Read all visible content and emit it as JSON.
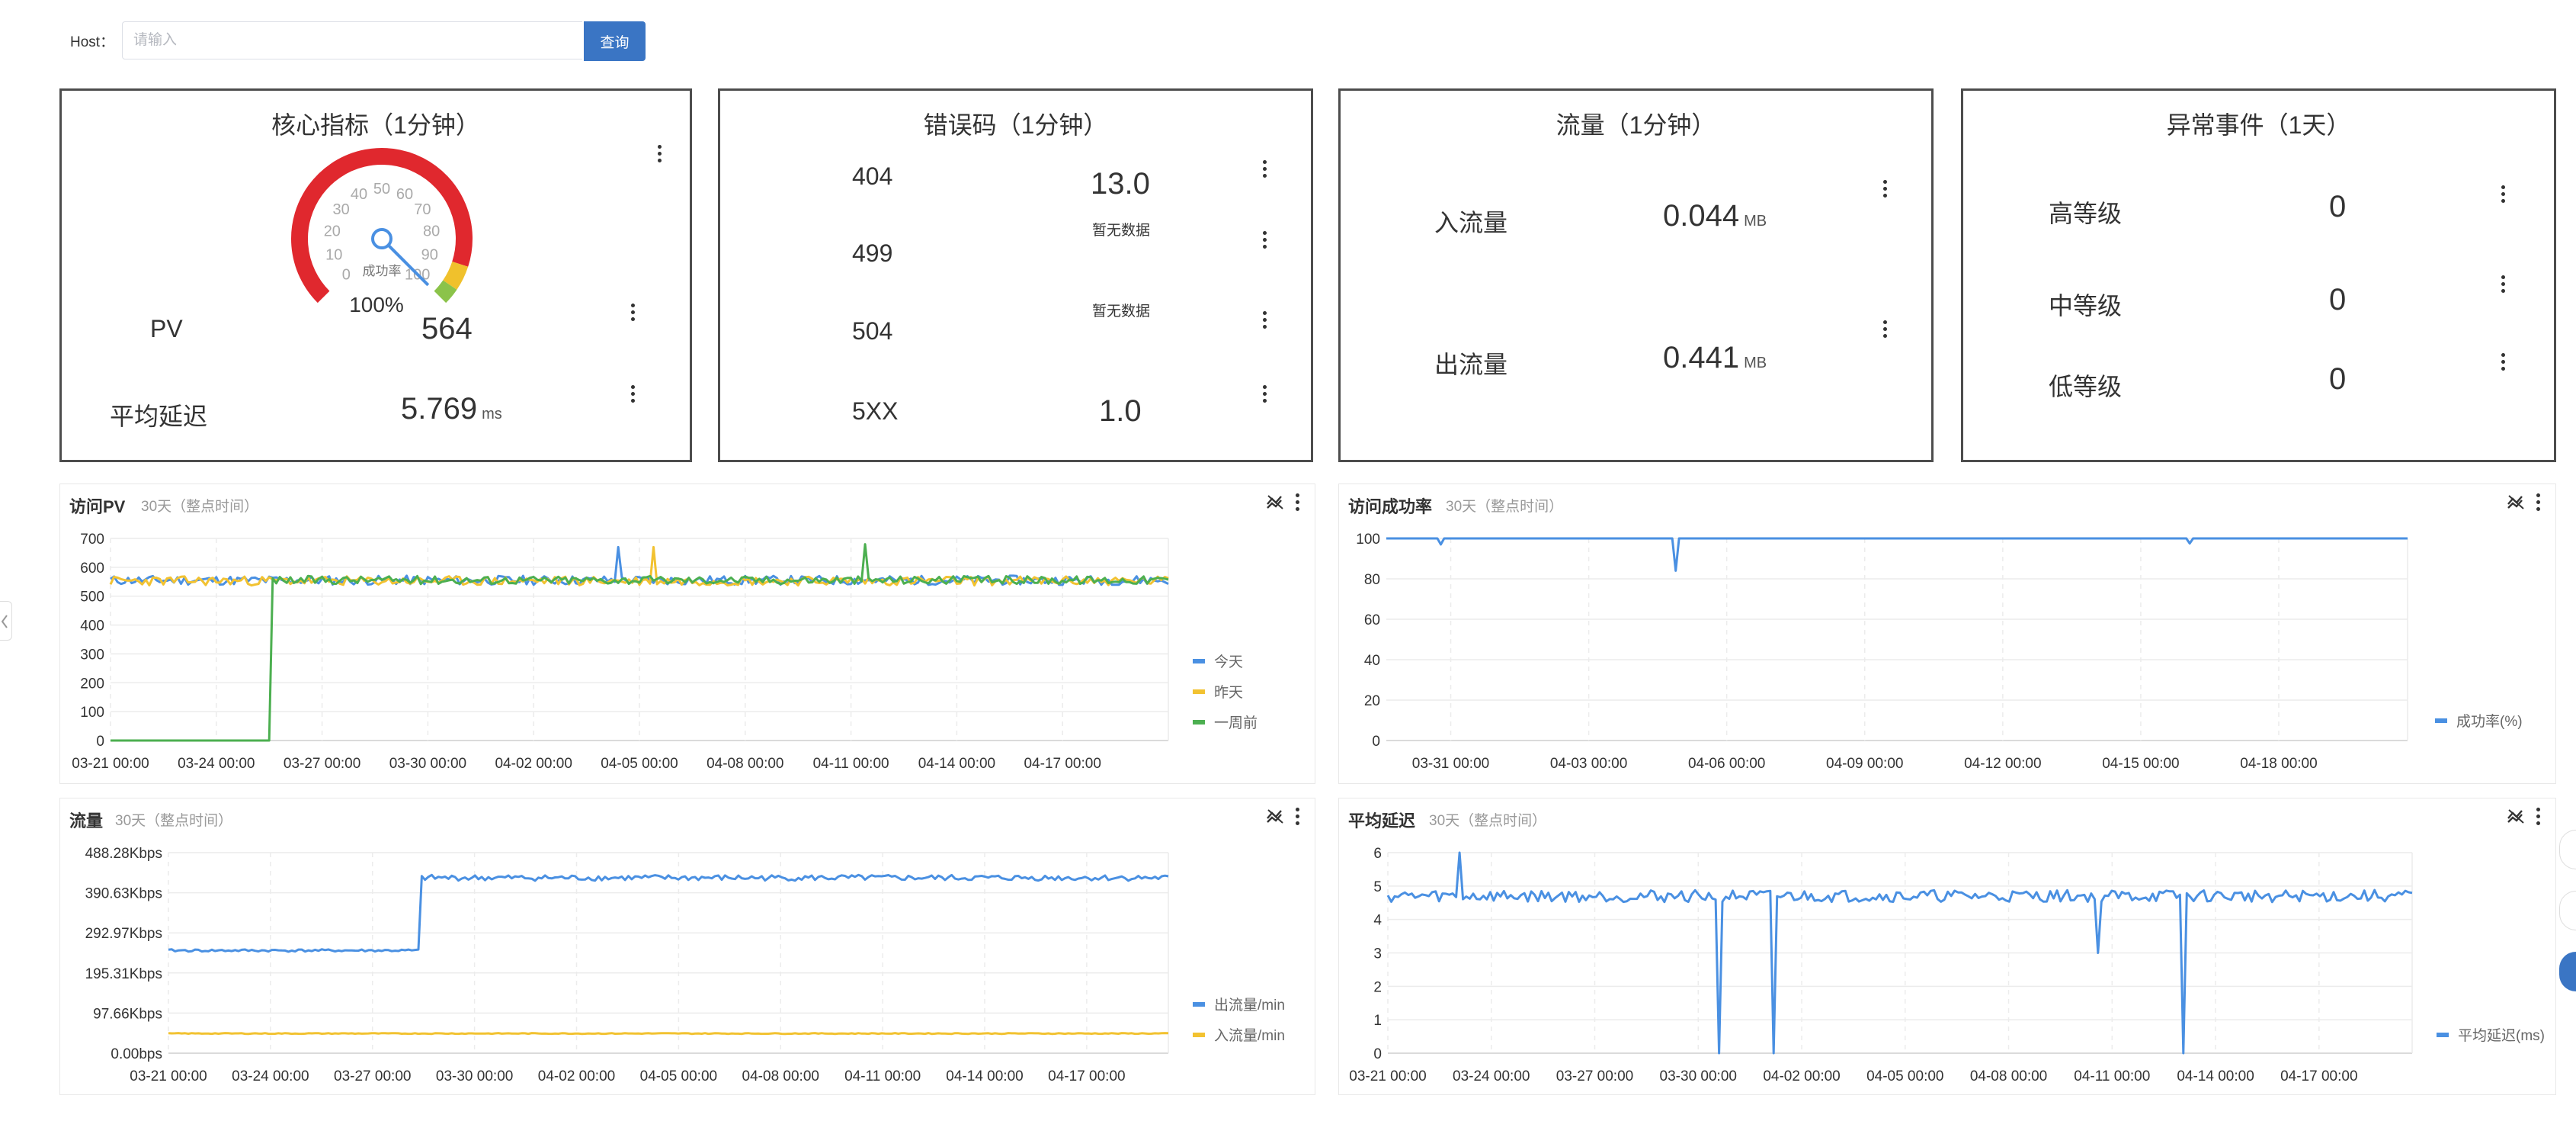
{
  "search": {
    "label": "Host：",
    "placeholder": "请输入",
    "value": "",
    "button": "查询"
  },
  "cards": {
    "core": {
      "title": "核心指标（1分钟）",
      "gauge": {
        "ticks": [
          "0",
          "10",
          "20",
          "30",
          "40",
          "50",
          "60",
          "70",
          "80",
          "90",
          "100"
        ],
        "caption": "成功率",
        "value_text": "100%",
        "value": 100
      },
      "pv": {
        "label": "PV",
        "value": "564"
      },
      "latency": {
        "label": "平均延迟",
        "value": "5.769",
        "unit": "ms"
      }
    },
    "errors": {
      "title": "错误码（1分钟）",
      "rows": [
        {
          "code": "404",
          "value": "13.0"
        },
        {
          "code": "499",
          "value": "暂无数据"
        },
        {
          "code": "504",
          "value": "暂无数据"
        },
        {
          "code": "5XX",
          "value": "1.0"
        }
      ]
    },
    "traffic": {
      "title": "流量（1分钟）",
      "inbound": {
        "label": "入流量",
        "value": "0.044",
        "unit": "MB"
      },
      "outbound": {
        "label": "出流量",
        "value": "0.441",
        "unit": "MB"
      }
    },
    "events": {
      "title": "异常事件（1天）",
      "rows": [
        {
          "level": "高等级",
          "value": "0"
        },
        {
          "level": "中等级",
          "value": "0"
        },
        {
          "level": "低等级",
          "value": "0"
        }
      ]
    }
  },
  "chart_data": [
    {
      "id": "pv",
      "type": "line",
      "title": "访问PV",
      "subtitle": "30天（整点时间）",
      "x_ticks": [
        "03-21 00:00",
        "03-24 00:00",
        "03-27 00:00",
        "03-30 00:00",
        "04-02 00:00",
        "04-05 00:00",
        "04-08 00:00",
        "04-11 00:00",
        "04-14 00:00",
        "04-17 00:00"
      ],
      "x_range": [
        0,
        30
      ],
      "ylim": [
        0,
        700
      ],
      "y_ticks": [
        "0",
        "100",
        "200",
        "300",
        "400",
        "500",
        "600",
        "700"
      ],
      "grid": true,
      "legend_position": "bottom-right",
      "series": [
        {
          "name": "今天",
          "color": "#4a90e2",
          "base": 555,
          "amp": 16,
          "seed": 11,
          "spikes": [
            [
              14.4,
              670
            ]
          ]
        },
        {
          "name": "昨天",
          "color": "#f2c231",
          "base": 553,
          "amp": 16,
          "seed": 23,
          "spikes": [
            [
              15.4,
              670
            ]
          ]
        },
        {
          "name": "一周前",
          "color": "#4caf50",
          "base": 556,
          "amp": 14,
          "seed": 37,
          "spikes": [
            [
              21.4,
              680
            ]
          ],
          "zero_until": 4.6
        }
      ]
    },
    {
      "id": "success",
      "type": "line",
      "title": "访问成功率",
      "subtitle": "30天（整点时间）",
      "x_ticks": [
        "03-31 00:00",
        "04-03 00:00",
        "04-06 00:00",
        "04-09 00:00",
        "04-12 00:00",
        "04-15 00:00",
        "04-18 00:00"
      ],
      "x_range": [
        0,
        22.2
      ],
      "ylim": [
        0,
        100
      ],
      "y_ticks": [
        "0",
        "20",
        "40",
        "60",
        "80",
        "100"
      ],
      "grid": true,
      "legend_position": "bottom-right",
      "series": [
        {
          "name": "成功率(%)",
          "color": "#4a90e2",
          "base": 100,
          "amp": 0,
          "seed": 5,
          "dips": [
            [
              1.2,
              97
            ],
            [
              6.3,
              84
            ],
            [
              17.5,
              97.5
            ]
          ]
        }
      ]
    },
    {
      "id": "traffic",
      "type": "line",
      "title": "流量",
      "subtitle": "30天（整点时间）",
      "x_ticks": [
        "03-21 00:00",
        "03-24 00:00",
        "03-27 00:00",
        "03-30 00:00",
        "04-02 00:00",
        "04-05 00:00",
        "04-08 00:00",
        "04-11 00:00",
        "04-14 00:00",
        "04-17 00:00"
      ],
      "x_range": [
        0,
        29.4
      ],
      "ylim": [
        0,
        488.28
      ],
      "y_ticks": [
        "0.00bps",
        "97.66Kbps",
        "195.31Kbps",
        "292.97Kbps",
        "390.63Kbps",
        "488.28Kbps"
      ],
      "y_unit": "Kbps",
      "grid": true,
      "legend_position": "bottom-right",
      "series": [
        {
          "name": "出流量/min",
          "color": "#4a90e2",
          "base": 250,
          "amp": 3,
          "seed": 41,
          "step_at": 7.4,
          "step_to": 427,
          "amp_after": 7
        },
        {
          "name": "入流量/min",
          "color": "#f2c231",
          "base": 48,
          "amp": 1,
          "seed": 43
        }
      ]
    },
    {
      "id": "latency",
      "type": "line",
      "title": "平均延迟",
      "subtitle": "30天（整点时间）",
      "x_ticks": [
        "03-21 00:00",
        "03-24 00:00",
        "03-27 00:00",
        "03-30 00:00",
        "04-02 00:00",
        "04-05 00:00",
        "04-08 00:00",
        "04-11 00:00",
        "04-14 00:00",
        "04-17 00:00"
      ],
      "x_range": [
        0,
        29.7
      ],
      "ylim": [
        0,
        6
      ],
      "y_ticks": [
        "0",
        "1",
        "2",
        "3",
        "4",
        "5",
        "6"
      ],
      "grid": true,
      "legend_position": "bottom-right",
      "series": [
        {
          "name": "平均延迟(ms)",
          "color": "#4a90e2",
          "base": 4.7,
          "amp": 0.18,
          "seed": 59,
          "spikes": [
            [
              2.1,
              6
            ]
          ],
          "dips": [
            [
              9.6,
              0
            ],
            [
              11.2,
              0
            ],
            [
              20.6,
              3.0
            ],
            [
              23.1,
              0
            ]
          ]
        }
      ]
    }
  ]
}
